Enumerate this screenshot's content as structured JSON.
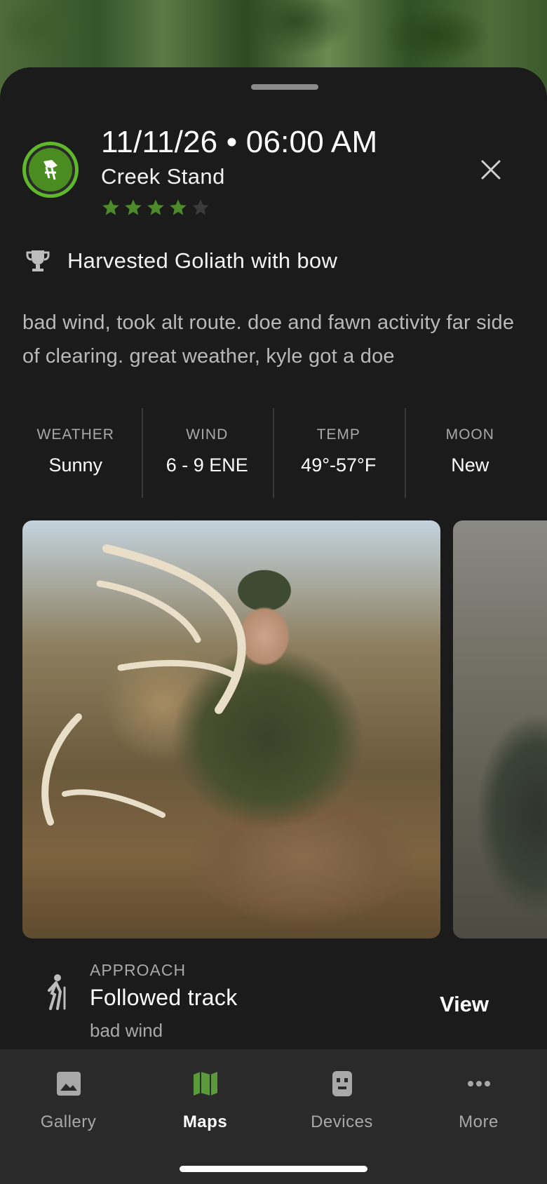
{
  "entry": {
    "datetime": "11/11/26 • 06:00 AM",
    "stand_name": "Creek Stand",
    "rating": 4,
    "rating_max": 5,
    "harvest_text": "Harvested Goliath with bow",
    "notes": "bad wind, took alt route. doe and fawn activity far side of clearing. great weather, kyle got a doe"
  },
  "conditions": [
    {
      "label": "WEATHER",
      "value": "Sunny"
    },
    {
      "label": "WIND",
      "value": "6 - 9 ENE"
    },
    {
      "label": "TEMP",
      "value": "49°-57°F"
    },
    {
      "label": "MOON",
      "value": "New"
    }
  ],
  "approach": {
    "label": "APPROACH",
    "title": "Followed track",
    "subtitle": "bad wind",
    "view_label": "View"
  },
  "tabs": [
    {
      "label": "Gallery",
      "icon": "image-icon",
      "active": false
    },
    {
      "label": "Maps",
      "icon": "map-icon",
      "active": true
    },
    {
      "label": "Devices",
      "icon": "trail-camera-icon",
      "active": false
    },
    {
      "label": "More",
      "icon": "more-dots-icon",
      "active": false
    }
  ],
  "colors": {
    "accent": "#5fb82a",
    "star_filled": "#4f8a2a",
    "star_empty": "#3a3a3a",
    "sheet_bg": "#1b1b1b",
    "tabbar_bg": "#2a2a2a"
  }
}
